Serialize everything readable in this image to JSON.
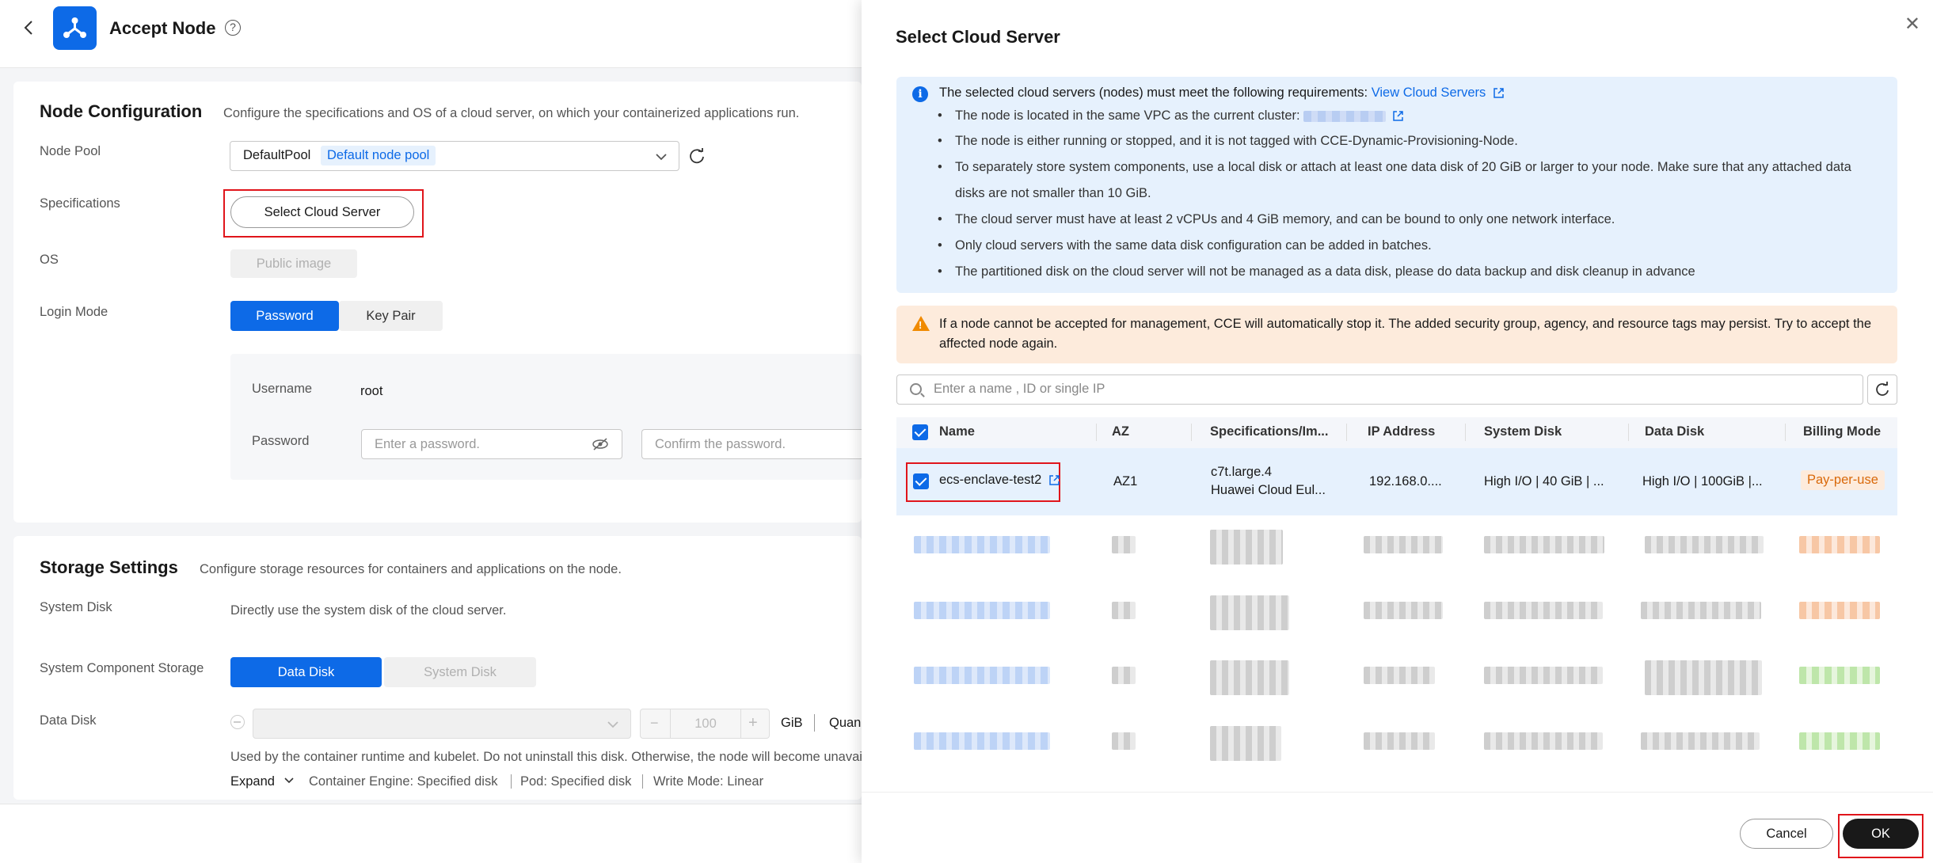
{
  "header": {
    "title": "Accept Node"
  },
  "node_config": {
    "title": "Node Configuration",
    "desc": "Configure the specifications and OS of a cloud server, on which your containerized applications run.",
    "node_pool_label": "Node Pool",
    "node_pool_value": "DefaultPool",
    "node_pool_tag": "Default node pool",
    "specs_label": "Specifications",
    "select_server_btn": "Select Cloud Server",
    "os_label": "OS",
    "os_btn": "Public image",
    "login_label": "Login Mode",
    "login_password": "Password",
    "login_keypair": "Key Pair",
    "username_label": "Username",
    "username_value": "root",
    "password_label": "Password",
    "password_ph": "Enter a password.",
    "confirm_ph": "Confirm the password."
  },
  "storage": {
    "title": "Storage Settings",
    "desc": "Configure storage resources for containers and applications on the node.",
    "system_disk_label": "System Disk",
    "system_disk_desc": "Directly use the system disk of the cloud server.",
    "component_label": "System Component Storage",
    "data_disk_btn": "Data Disk",
    "system_disk_btn": "System Disk",
    "data_disk_label": "Data Disk",
    "size_value": "100",
    "unit": "GiB",
    "quan": "Quan",
    "usage_note": "Used by the container runtime and kubelet. Do not uninstall this disk. Otherwise, the node will become unavai",
    "expand": "Expand",
    "engine": "Container Engine: Specified disk",
    "pod": "Pod: Specified disk",
    "write_mode": "Write Mode: Linear"
  },
  "drawer": {
    "title": "Select Cloud Server",
    "info_head": "The selected cloud servers (nodes) must meet the following requirements:",
    "info_link": "View Cloud Servers",
    "reqs": [
      "The node is located in the same VPC as the current cluster:",
      "The node is either running or stopped, and it is not tagged with CCE-Dynamic-Provisioning-Node.",
      "To separately store system components, use a local disk or attach at least one data disk of 20 GiB or larger to your node. Make sure that any attached data",
      "disks are not smaller than 10 GiB.",
      "The cloud server must have at least 2 vCPUs and 4 GiB memory, and can be bound to only one network interface.",
      "Only cloud servers with the same data disk configuration can be added in batches.",
      "The partitioned disk on the cloud server will not be managed as a data disk, please do data backup and disk cleanup in advance"
    ],
    "warning": "If a node cannot be accepted for management, CCE will automatically stop it. The added security group, agency, and resource tags may persist. Try to accept the affected node again.",
    "search_ph": "Enter a name , ID or single IP",
    "columns": [
      "Name",
      "AZ",
      "Specifications/Im...",
      "IP Address",
      "System Disk",
      "Data Disk",
      "Billing Mode"
    ],
    "row": {
      "name": "ecs-enclave-test2",
      "az": "AZ1",
      "spec1": "c7t.large.4",
      "spec2": "Huawei Cloud Eul...",
      "ip": "192.168.0....",
      "system_disk": "High I/O | 40 GiB | ...",
      "data_disk": "High I/O | 100GiB |...",
      "billing": "Pay-per-use"
    },
    "cancel": "Cancel",
    "ok": "OK"
  }
}
